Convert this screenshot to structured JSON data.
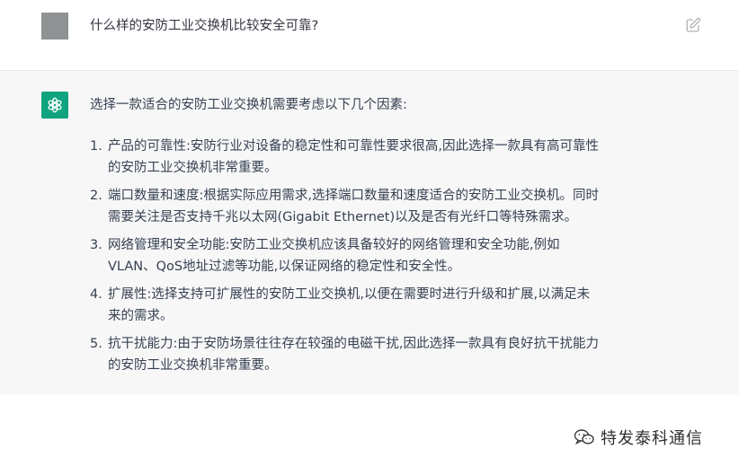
{
  "user_message": {
    "text": "什么样的安防工业交换机比较安全可靠?"
  },
  "assistant_message": {
    "intro": "选择一款适合的安防工业交换机需要考虑以下几个因素:",
    "points": [
      {
        "num": "1.",
        "line1": "产品的可靠性:安防行业对设备的稳定性和可靠性要求很高,因此选择一款具有高可靠性",
        "line2": "的安防工业交换机非常重要。"
      },
      {
        "num": "2.",
        "line1": "端口数量和速度:根据实际应用需求,选择端口数量和速度适合的安防工业交换机。同时",
        "line2": "需要关注是否支持千兆以太网(Gigabit Ethernet)以及是否有光纤口等特殊需求。"
      },
      {
        "num": "3.",
        "line1": "网络管理和安全功能:安防工业交换机应该具备较好的网络管理和安全功能,例如",
        "line2": "VLAN、QoS地址过滤等功能,以保证网络的稳定性和安全性。"
      },
      {
        "num": "4.",
        "line1": "扩展性:选择支持可扩展性的安防工业交换机,以便在需要时进行升级和扩展,以满足未",
        "line2": "来的需求。"
      },
      {
        "num": "5.",
        "line1": "抗干扰能力:由于安防场景往往存在较强的电磁干扰,因此选择一款具有良好抗干扰能力",
        "line2": "的安防工业交换机非常重要。"
      }
    ]
  },
  "watermark": {
    "text": "特发泰科通信"
  },
  "icons": {
    "edit": "edit-icon",
    "bot": "openai-logo-icon",
    "watermark": "wechat-icon"
  },
  "colors": {
    "assistant_bg": "#f7f7f8",
    "bot_avatar": "#10a37f",
    "user_avatar": "#8e9293"
  }
}
